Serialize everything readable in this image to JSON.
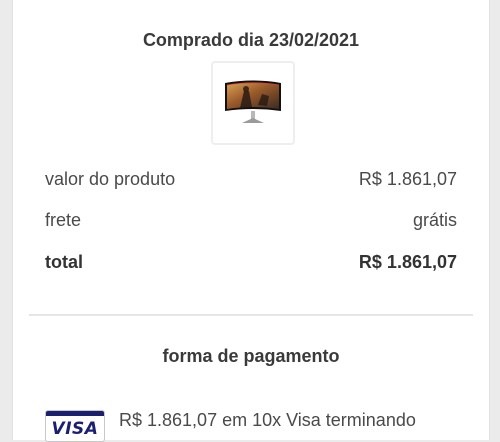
{
  "purchase": {
    "date_heading": "Comprado dia 23/02/2021"
  },
  "product": {
    "image_icon": "curved-monitor-icon"
  },
  "summary": {
    "rows": [
      {
        "label": "valor do produto",
        "value": "R$ 1.861,07"
      },
      {
        "label": "frete",
        "value": "grátis"
      },
      {
        "label": "total",
        "value": "R$ 1.861,07"
      }
    ]
  },
  "payment": {
    "title": "forma de pagamento",
    "card_brand": "VISA",
    "description": "R$ 1.861,07 em 10x Visa terminando"
  },
  "colors": {
    "visa_blue": "#1a1f71",
    "background": "#ebebeb",
    "card": "#ffffff"
  }
}
